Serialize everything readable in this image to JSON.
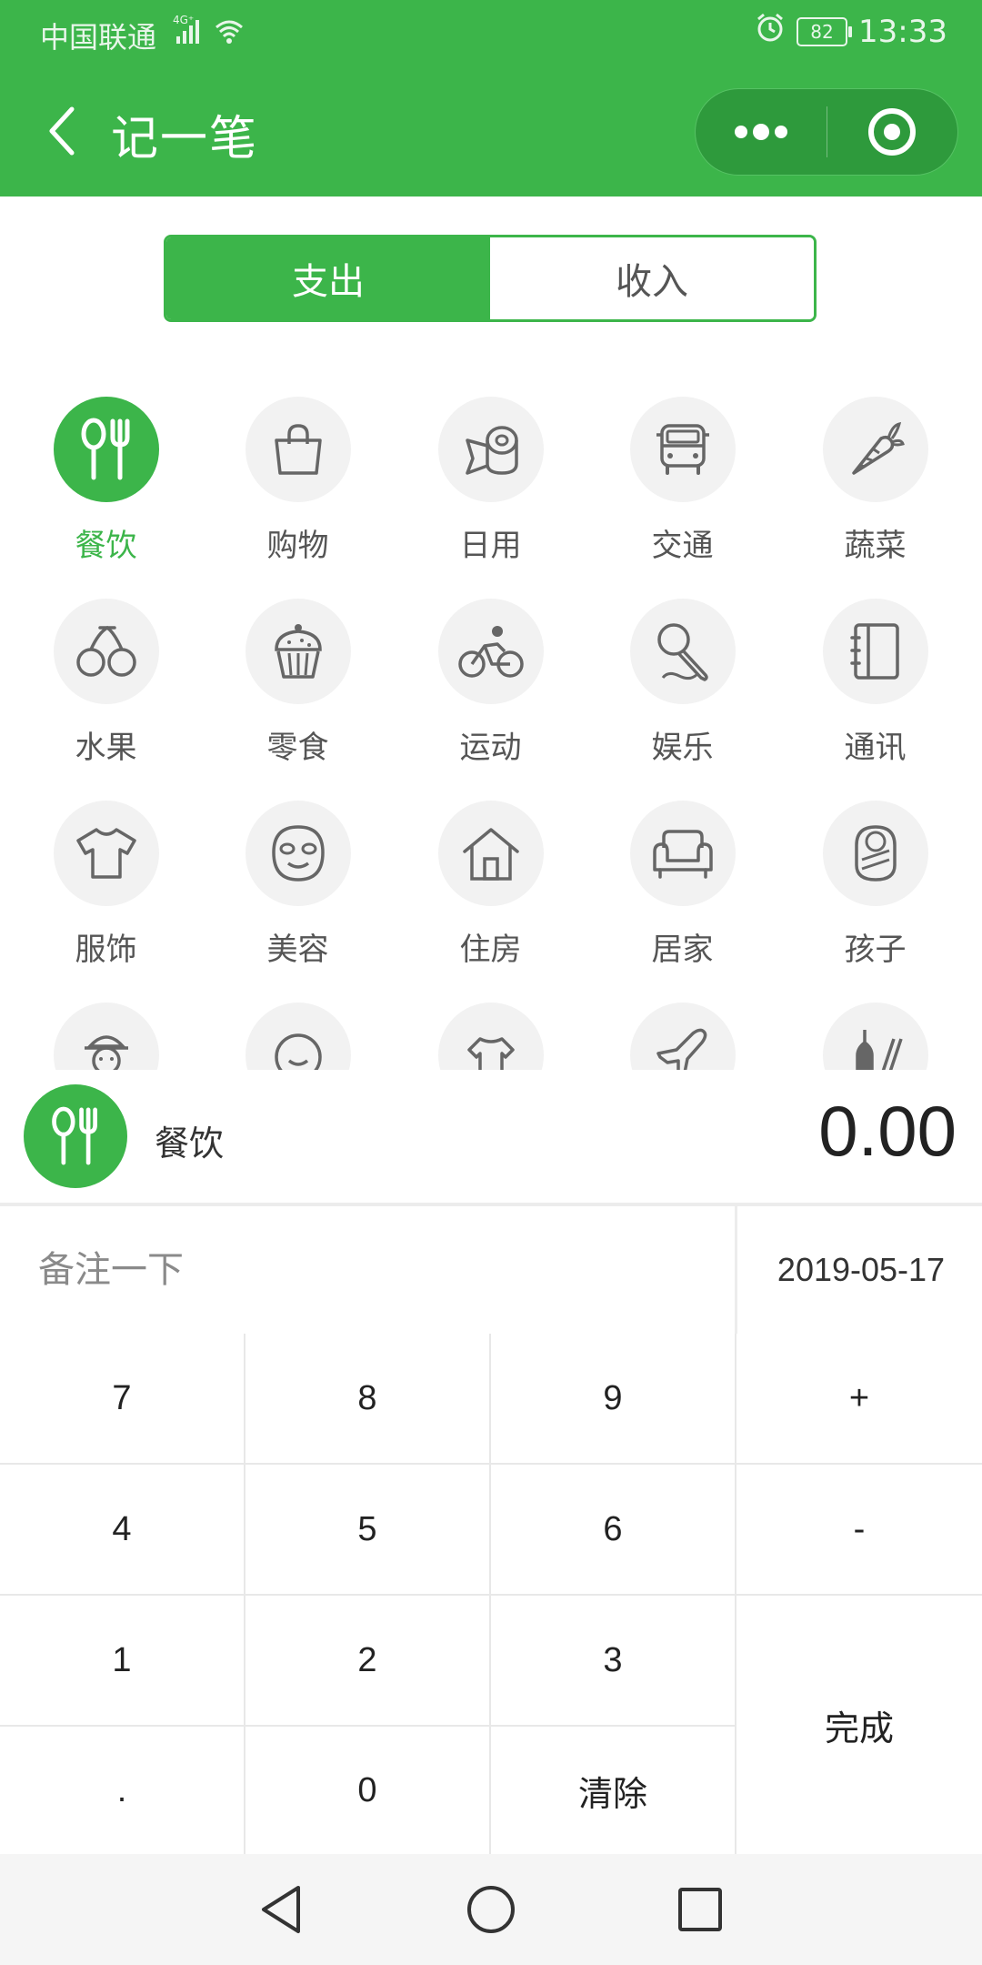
{
  "status_bar": {
    "carrier": "中国联通",
    "network": "4G",
    "battery": "82",
    "time": "13:33"
  },
  "nav": {
    "title": "记一笔",
    "back_icon": "chevron-left-icon",
    "more_icon": "more-dots-icon",
    "close_icon": "target-icon"
  },
  "tabs": [
    {
      "label": "支出",
      "active": true
    },
    {
      "label": "收入",
      "active": false
    }
  ],
  "categories": [
    {
      "label": "餐饮",
      "icon": "utensils-icon",
      "active": true
    },
    {
      "label": "购物",
      "icon": "shopping-bag-icon"
    },
    {
      "label": "日用",
      "icon": "tissue-roll-icon"
    },
    {
      "label": "交通",
      "icon": "bus-icon"
    },
    {
      "label": "蔬菜",
      "icon": "carrot-icon"
    },
    {
      "label": "水果",
      "icon": "cherry-icon"
    },
    {
      "label": "零食",
      "icon": "cupcake-icon"
    },
    {
      "label": "运动",
      "icon": "bicycle-icon"
    },
    {
      "label": "娱乐",
      "icon": "microphone-icon"
    },
    {
      "label": "通讯",
      "icon": "notebook-icon"
    },
    {
      "label": "服饰",
      "icon": "tshirt-icon"
    },
    {
      "label": "美容",
      "icon": "face-mask-icon"
    },
    {
      "label": "住房",
      "icon": "house-icon"
    },
    {
      "label": "居家",
      "icon": "sofa-icon"
    },
    {
      "label": "孩子",
      "icon": "baby-icon"
    }
  ],
  "partial_row_icons": [
    "elder-icon",
    "smiley-icon",
    "pet-icon",
    "airplane-icon",
    "drinks-icon"
  ],
  "selected": {
    "label": "餐饮",
    "amount": "0.00"
  },
  "note": {
    "placeholder": "备注一下",
    "value": ""
  },
  "date": "2019-05-17",
  "keypad": {
    "k7": "7",
    "k8": "8",
    "k9": "9",
    "plus": "+",
    "k4": "4",
    "k5": "5",
    "k6": "6",
    "minus": "-",
    "k1": "1",
    "k2": "2",
    "k3": "3",
    "dot": ".",
    "k0": "0",
    "clear": "清除",
    "done": "完成"
  },
  "colors": {
    "primary": "#3cb54a",
    "icon_gray": "#666666",
    "circle_bg": "#f2f2f2"
  }
}
